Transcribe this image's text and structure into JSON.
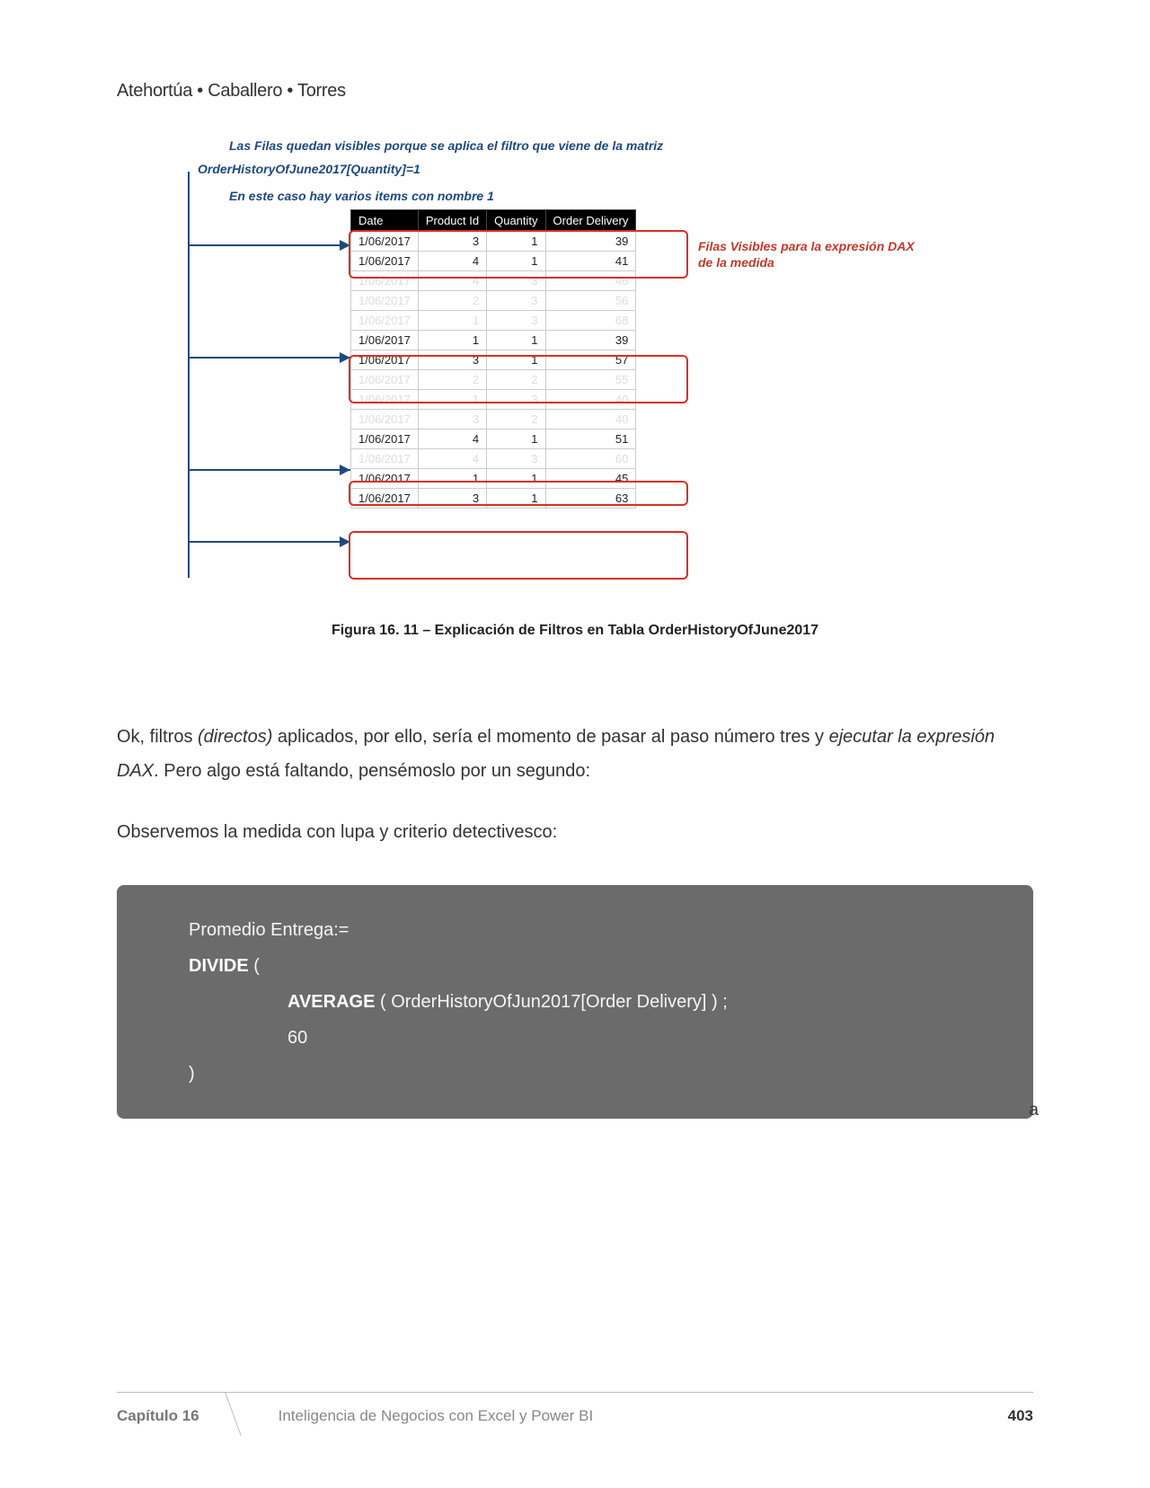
{
  "header": {
    "authors": "Atehortúa • Caballero • Torres"
  },
  "annotations": {
    "matrix": "Las Filas quedan visibles porque se aplica el filtro que viene de la matriz",
    "formula": "OrderHistoryOfJune2017[Quantity]=1",
    "items": "En este caso hay varios items con nombre 1",
    "right": "Filas Visibles para la expresión DAX de la medida"
  },
  "table": {
    "headers": [
      "Date",
      "Product Id",
      "Quantity",
      "Order Delivery"
    ],
    "rows": [
      {
        "date": "1/06/2017",
        "pid": "3",
        "qty": "1",
        "od": "39",
        "solid": true
      },
      {
        "date": "1/06/2017",
        "pid": "4",
        "qty": "1",
        "od": "41",
        "solid": true
      },
      {
        "date": "1/06/2017",
        "pid": "4",
        "qty": "3",
        "od": "46",
        "solid": false
      },
      {
        "date": "1/06/2017",
        "pid": "2",
        "qty": "3",
        "od": "56",
        "solid": false
      },
      {
        "date": "1/06/2017",
        "pid": "1",
        "qty": "3",
        "od": "68",
        "solid": false
      },
      {
        "date": "1/06/2017",
        "pid": "1",
        "qty": "1",
        "od": "39",
        "solid": true
      },
      {
        "date": "1/06/2017",
        "pid": "3",
        "qty": "1",
        "od": "57",
        "solid": true
      },
      {
        "date": "1/06/2017",
        "pid": "2",
        "qty": "2",
        "od": "55",
        "solid": false
      },
      {
        "date": "1/06/2017",
        "pid": "1",
        "qty": "3",
        "od": "40",
        "solid": false
      },
      {
        "date": "1/06/2017",
        "pid": "3",
        "qty": "2",
        "od": "40",
        "solid": false
      },
      {
        "date": "1/06/2017",
        "pid": "4",
        "qty": "1",
        "od": "51",
        "solid": true
      },
      {
        "date": "1/06/2017",
        "pid": "4",
        "qty": "3",
        "od": "60",
        "solid": false
      },
      {
        "date": "1/06/2017",
        "pid": "1",
        "qty": "1",
        "od": "45",
        "solid": true
      },
      {
        "date": "1/06/2017",
        "pid": "3",
        "qty": "1",
        "od": "63",
        "solid": true
      }
    ]
  },
  "caption": "Figura 16. 11 – Explicación de Filtros en Tabla OrderHistoryOfJune2017",
  "paragraphs": {
    "p1a": "Ok, filtros ",
    "p1b": "(directos)",
    "p1c": " aplicados, por ello, sería el momento de pasar al paso número tres y ",
    "p1d": "ejecutar la expresión DAX",
    "p1e": ". Pero algo está faltando, pensémoslo por un segundo:",
    "p2": "Observemos la medida con lupa y criterio detectivesco:"
  },
  "code": {
    "l1": "Promedio Entrega:=",
    "l2a": "DIVIDE",
    "l2b": " (",
    "l3a": "AVERAGE",
    "l3b": " ( OrderHistoryOfJun2017[Order Delivery] ) ;",
    "l4": " 60",
    "l5": ")"
  },
  "stray": "a",
  "footer": {
    "chapter": "Capítulo 16",
    "book": "Inteligencia de Negocios con Excel y Power BI",
    "page": "403"
  }
}
